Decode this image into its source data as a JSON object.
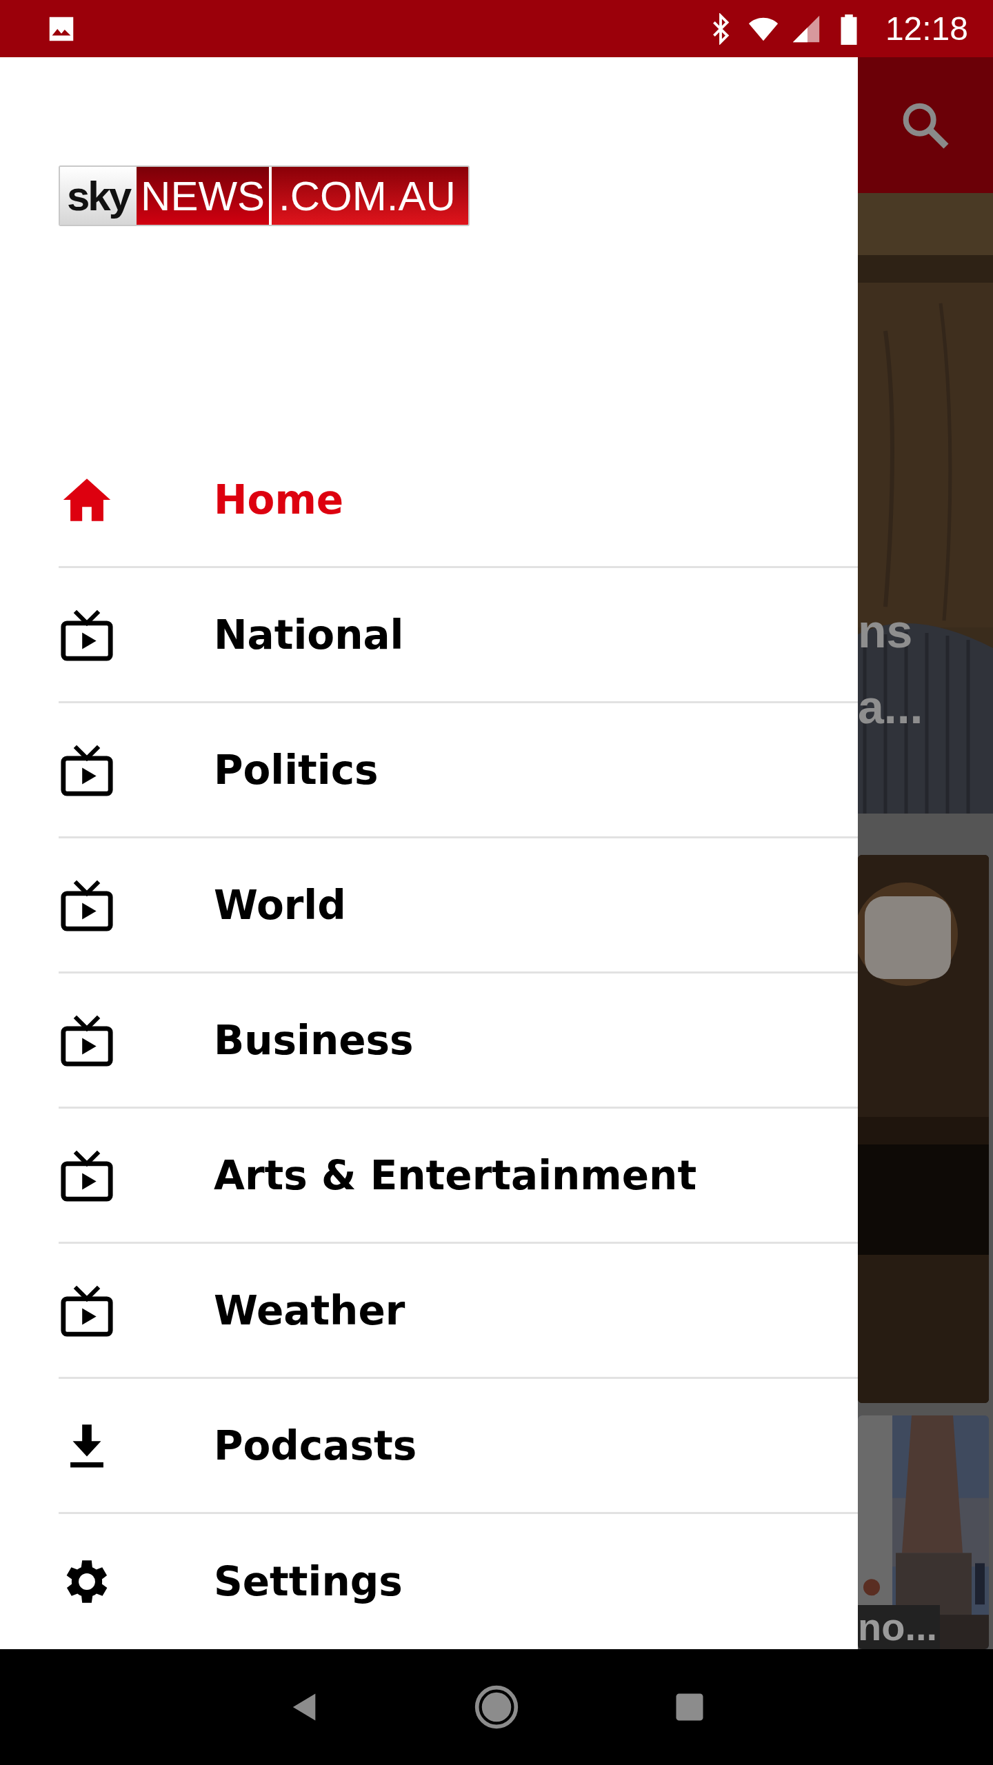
{
  "status_bar": {
    "time": "12:18"
  },
  "logo": {
    "parts": [
      "sky",
      "NEWS",
      ".COM.AU"
    ]
  },
  "menu": [
    {
      "label": "Home",
      "kind": "home",
      "selected": true
    },
    {
      "label": "National",
      "kind": "tv",
      "selected": false
    },
    {
      "label": "Politics",
      "kind": "tv",
      "selected": false
    },
    {
      "label": "World",
      "kind": "tv",
      "selected": false
    },
    {
      "label": "Business",
      "kind": "tv",
      "selected": false
    },
    {
      "label": "Arts & Entertainment",
      "kind": "tv",
      "selected": false
    },
    {
      "label": "Weather",
      "kind": "tv",
      "selected": false
    },
    {
      "label": "Podcasts",
      "kind": "download",
      "selected": false
    },
    {
      "label": "Settings",
      "kind": "settings",
      "selected": false
    }
  ],
  "background": {
    "headline_fragments": [
      "ns",
      "a..."
    ],
    "card_fragment": "no..."
  }
}
